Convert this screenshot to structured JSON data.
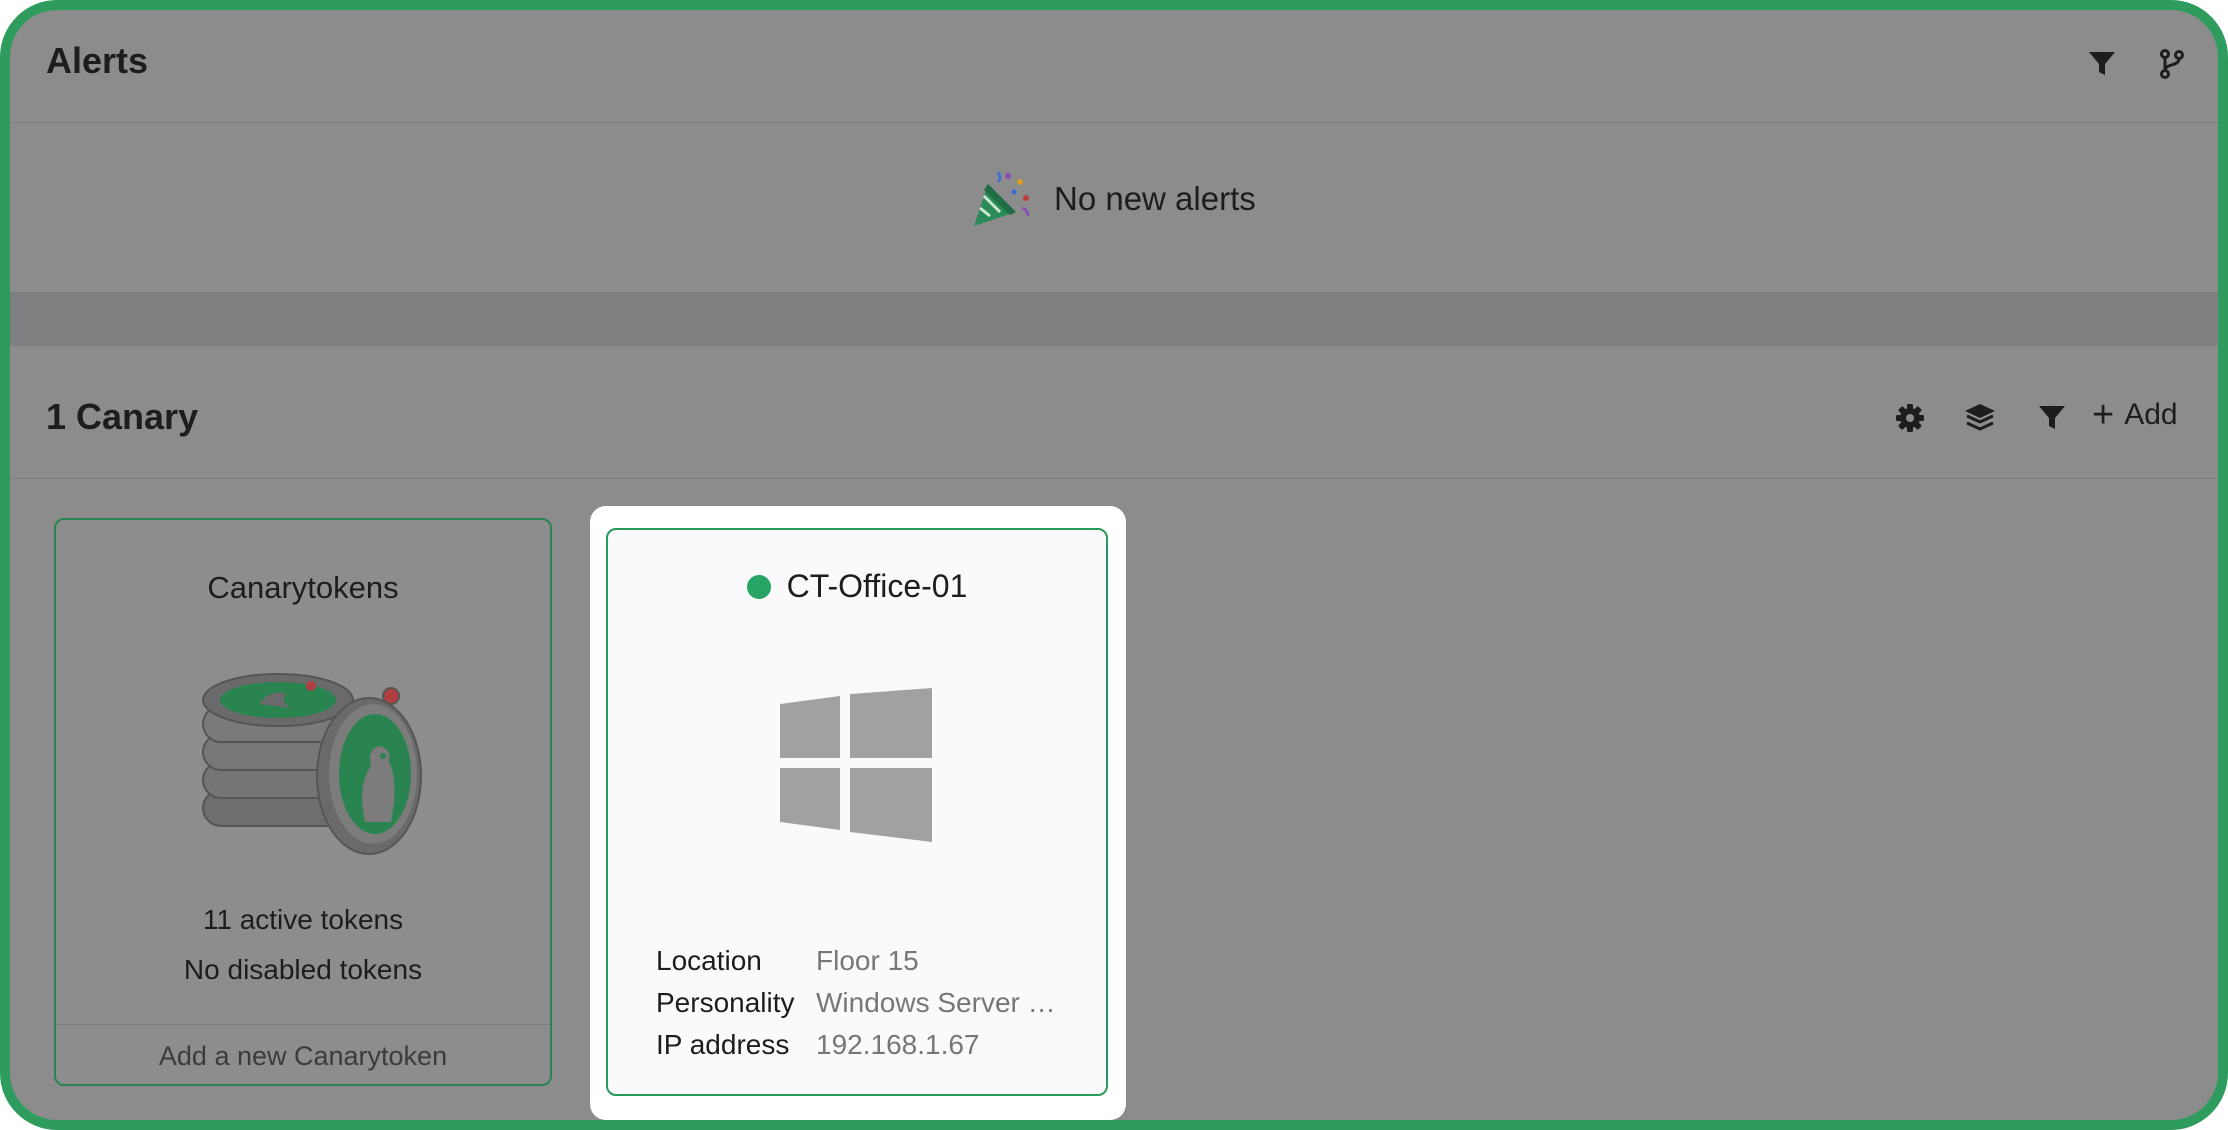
{
  "alerts": {
    "title": "Alerts",
    "empty_message": "No new alerts"
  },
  "canaries": {
    "title": "1 Canary",
    "add_label": "Add"
  },
  "tokens_card": {
    "title": "Canarytokens",
    "active": "11 active tokens",
    "disabled": "No disabled tokens",
    "add_link": "Add a new Canarytoken"
  },
  "device": {
    "name": "CT-Office-01",
    "status_color": "#26a565",
    "details": [
      {
        "label": "Location",
        "value": "Floor 15"
      },
      {
        "label": "Personality",
        "value": "Windows Server …"
      },
      {
        "label": "IP address",
        "value": "192.168.1.67"
      }
    ]
  },
  "colors": {
    "accent": "#2e9c5c",
    "overlay": "#8c8c8c"
  }
}
